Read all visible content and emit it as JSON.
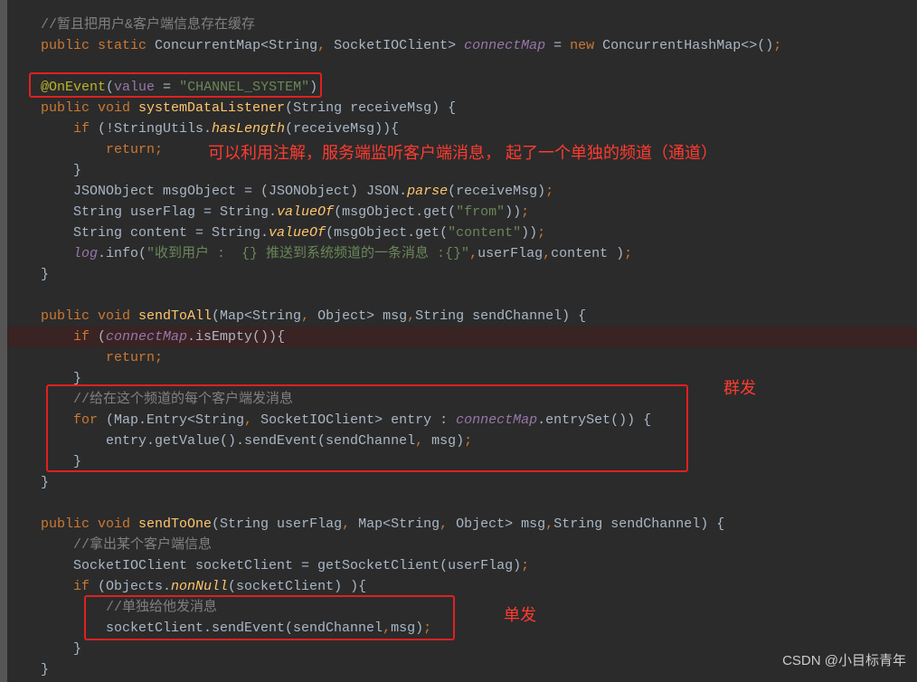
{
  "code": {
    "l1": "//暂且把用户&客户端信息存在缓存",
    "l2_public": "public",
    "l2_static": "static",
    "l2_rest1": " ConcurrentMap<String",
    "l2_c1": ",",
    "l2_rest2": " SocketIOClient> ",
    "l2_field": "connectMap",
    "l2_eq": " = ",
    "l2_new": "new",
    "l2_rest3": " ConcurrentHashMap<>()",
    "l2_semi": ";",
    "l4_anno": "@OnEvent",
    "l4_p1": "(",
    "l4_value": "value",
    "l4_eq": " = ",
    "l4_str": "\"CHANNEL_SYSTEM\"",
    "l4_p2": ")",
    "l5_pub": "public",
    "l5_void": " void ",
    "l5_fn": "systemDataListener",
    "l5_rest": "(String receiveMsg) {",
    "l6_if": "    if",
    "l6_rest": " (!StringUtils.",
    "l6_has": "hasLength",
    "l6_rest2": "(receiveMsg)){",
    "l7_ret": "        return",
    "l7_semi": ";",
    "l8": "    }",
    "l9_a": "    JSONObject msgObject = (JSONObject) JSON.",
    "l9_parse": "parse",
    "l9_b": "(receiveMsg)",
    "l9_semi": ";",
    "l10_a": "    String userFlag = String.",
    "l10_vo": "valueOf",
    "l10_b": "(msgObject.get(",
    "l10_str": "\"from\"",
    "l10_c": "))",
    "l10_semi": ";",
    "l11_a": "    String content = String.",
    "l11_vo": "valueOf",
    "l11_b": "(msgObject.get(",
    "l11_str": "\"content\"",
    "l11_c": "))",
    "l11_semi": ";",
    "l12_log": "    log",
    "l12_a": ".info(",
    "l12_str": "\"收到用户 :  {} 推送到系统频道的一条消息 :{}\"",
    "l12_b": ",",
    "l12_c": "userFlag",
    "l12_d": ",",
    "l12_e": "content )",
    "l12_semi": ";",
    "l13": "}",
    "l15_pub": "public",
    "l15_void": " void ",
    "l15_fn": "sendToAll",
    "l15_rest1": "(Map<String",
    "l15_c1": ",",
    "l15_rest2": " Object> msg",
    "l15_c2": ",",
    "l15_rest3": "String sendChannel) {",
    "l16_if": "    if",
    "l16_a": " (",
    "l16_cm": "connectMap",
    "l16_b": ".isEmpty()){",
    "l17_ret": "        return",
    "l17_semi": ";",
    "l18": "    }",
    "l19": "    //给在这个频道的每个客户端发消息",
    "l20_for": "    for",
    "l20_a": " (Map.Entry<String",
    "l20_c1": ",",
    "l20_b": " SocketIOClient> entry : ",
    "l20_cm": "connectMap",
    "l20_c": ".entrySet()) {",
    "l21_a": "        entry.getValue().sendEvent(sendChannel",
    "l21_c1": ",",
    "l21_b": " msg)",
    "l21_semi": ";",
    "l22": "    }",
    "l23": "}",
    "l25_pub": "public",
    "l25_void": " void ",
    "l25_fn": "sendToOne",
    "l25_a": "(String userFlag",
    "l25_c1": ",",
    "l25_b": " Map<String",
    "l25_c2": ",",
    "l25_c": " Object> msg",
    "l25_c3": ",",
    "l25_d": "String sendChannel) {",
    "l26": "    //拿出某个客户端信息",
    "l27_a": "    SocketIOClient socketClient = getSocketClient(userFlag)",
    "l27_semi": ";",
    "l28_if": "    if",
    "l28_a": " (Objects.",
    "l28_nn": "nonNull",
    "l28_b": "(socketClient) ){",
    "l29": "        //单独给他发消息",
    "l30_a": "        socketClient.sendEvent(sendChannel",
    "l30_c1": ",",
    "l30_b": "msg)",
    "l30_semi": ";",
    "l31": "    }",
    "l32": "}"
  },
  "annotations": {
    "red1": "可以利用注解，服务端监听客户端消息， 起了一个单独的频道（通道）",
    "red2": "群发",
    "red3": "单发"
  },
  "watermark": "CSDN @小目标青年"
}
